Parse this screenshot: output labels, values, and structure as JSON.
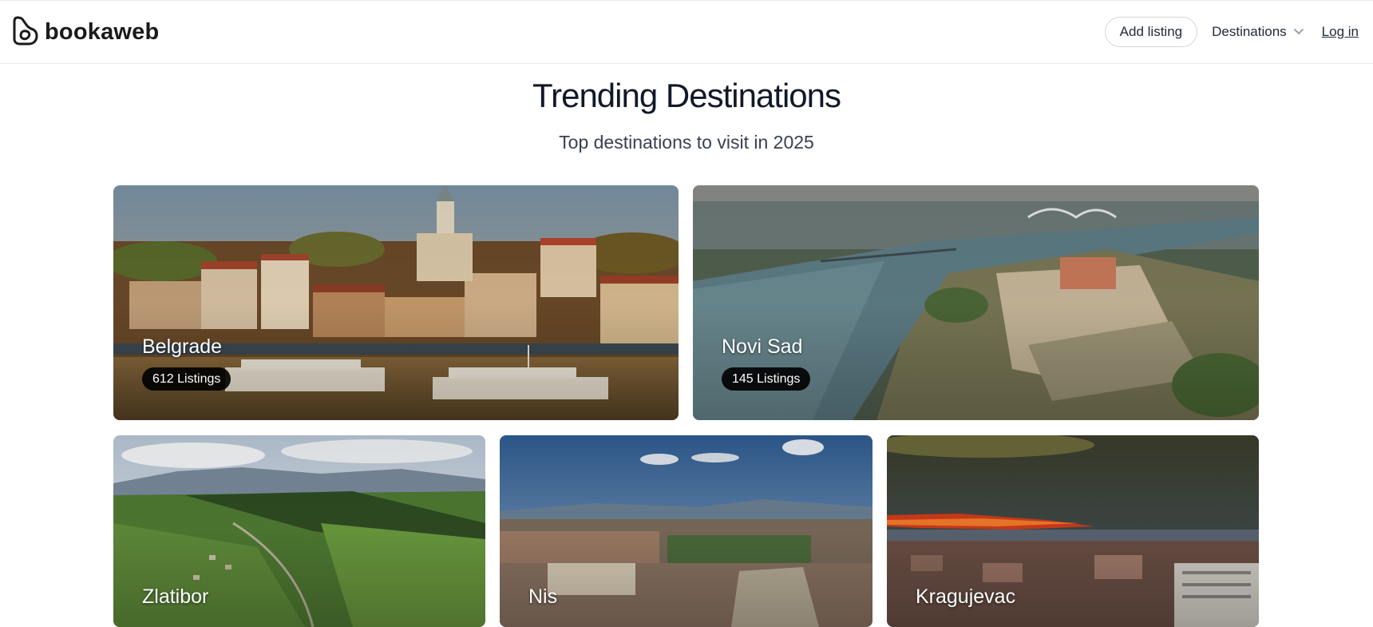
{
  "header": {
    "brand": "bookaweb",
    "add_listing": "Add listing",
    "destinations": "Destinations",
    "login": "Log in"
  },
  "hero": {
    "title": "Trending Destinations",
    "subtitle": "Top destinations to visit in 2025"
  },
  "destinations": [
    {
      "name": "Belgrade",
      "listings": "612 Listings"
    },
    {
      "name": "Novi Sad",
      "listings": "145 Listings"
    },
    {
      "name": "Zlatibor"
    },
    {
      "name": "Nis"
    },
    {
      "name": "Kragujevac"
    }
  ],
  "icons": {
    "logo": "bookaweb-logo-icon",
    "dropdown": "chevron-down-icon"
  }
}
